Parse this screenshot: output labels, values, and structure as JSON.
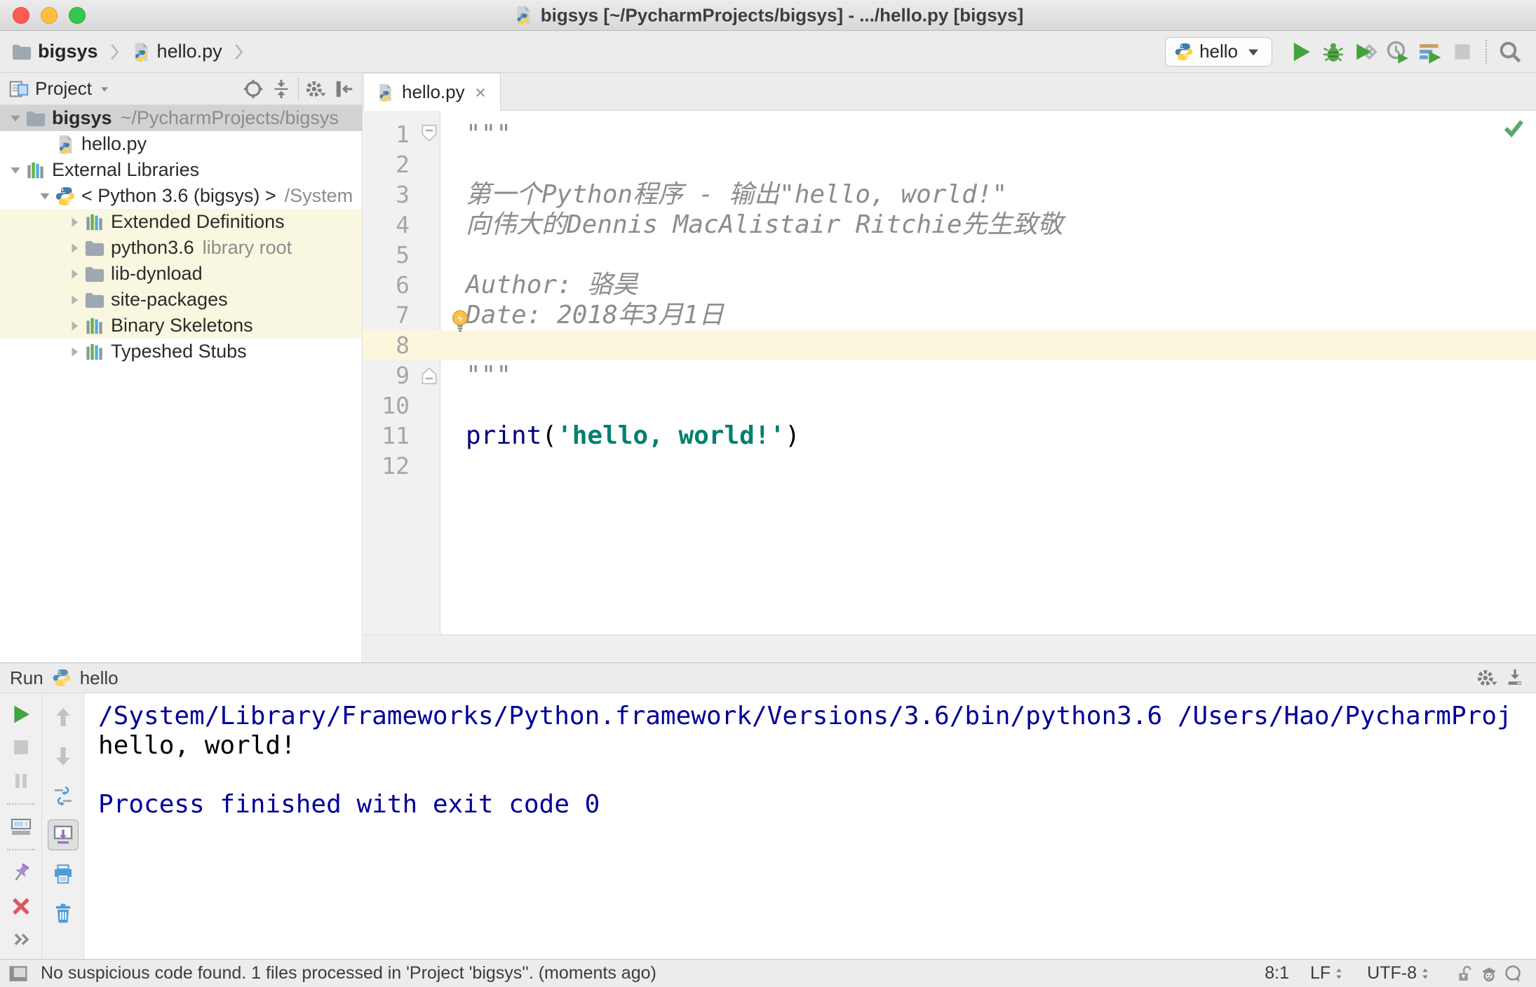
{
  "colors": {
    "toolbar_bg": "#ECECEC",
    "selection_gray": "#D2D2D2",
    "tree_highlight": "#FAF7E1",
    "caret_line": "#FCF6DD",
    "gutter_bg": "#F1F1F1",
    "gutter_border": "#D6D6D6",
    "run_green": "#45A33D",
    "error_red": "#DB5860",
    "pin_purple": "#A98FD0",
    "console_system": "#000099",
    "code_keyword": "#000080",
    "code_string": "#008070",
    "code_comment": "#8C8C8C",
    "icon_blue": "#4E9CD8",
    "ok_green": "#59A869"
  },
  "titlebar": {
    "title": "bigsys [~/PycharmProjects/bigsys] - .../hello.py [bigsys]",
    "window_buttons": [
      "close",
      "minimize",
      "zoom"
    ]
  },
  "toolbar": {
    "breadcrumbs": [
      {
        "label": "bigsys",
        "icon": "folder",
        "bold": true
      },
      {
        "label": "hello.py",
        "icon": "python-file",
        "bold": false
      }
    ],
    "run_config": {
      "icon": "python-logo",
      "label": "hello"
    },
    "actions": [
      "run",
      "debug",
      "run-with-coverage",
      "profiler",
      "concurrency-diagram",
      "stop",
      "separator",
      "search-everywhere"
    ]
  },
  "project_panel": {
    "title": "Project",
    "header_icons": [
      "locate",
      "collapse-all",
      "separator",
      "settings",
      "hide-panel"
    ],
    "tree": [
      {
        "label": "bigsys",
        "suffix": "~/PycharmProjects/bigsys",
        "level": 0,
        "expander": "down",
        "icon": "folder",
        "bold": true,
        "selected": true
      },
      {
        "label": "hello.py",
        "level": 1,
        "expander": "none",
        "icon": "python-file"
      },
      {
        "label": "External Libraries",
        "level": 0,
        "expander": "down",
        "icon": "library"
      },
      {
        "label": "< Python 3.6 (bigsys) >",
        "suffix": "/System",
        "level": 1,
        "expander": "down",
        "icon": "python-logo"
      },
      {
        "label": "Extended Definitions",
        "level": 2,
        "expander": "right",
        "icon": "library",
        "highlighted": true
      },
      {
        "label": "python3.6",
        "suffix": "library root",
        "level": 2,
        "expander": "right",
        "icon": "folder",
        "highlighted": true
      },
      {
        "label": "lib-dynload",
        "level": 2,
        "expander": "right",
        "icon": "folder",
        "highlighted": true
      },
      {
        "label": "site-packages",
        "level": 2,
        "expander": "right",
        "icon": "folder",
        "highlighted": true
      },
      {
        "label": "Binary Skeletons",
        "level": 2,
        "expander": "right",
        "icon": "library",
        "highlighted": true
      },
      {
        "label": "Typeshed Stubs",
        "level": 2,
        "expander": "right",
        "icon": "library",
        "highlighted": false
      }
    ]
  },
  "editor": {
    "tab": {
      "label": "hello.py",
      "icon": "python-file"
    },
    "inspection_status": "ok",
    "lines": [
      {
        "n": 1,
        "fold": "start",
        "tokens": [
          {
            "t": "\"\"\"",
            "c": "docstring"
          }
        ]
      },
      {
        "n": 2,
        "tokens": []
      },
      {
        "n": 3,
        "tokens": [
          {
            "t": "第一个Python程序 - 输出\"hello, world!\"",
            "c": "docstring"
          }
        ]
      },
      {
        "n": 4,
        "tokens": [
          {
            "t": "向伟大的Dennis MacAlistair Ritchie先生致敬",
            "c": "docstring"
          }
        ]
      },
      {
        "n": 5,
        "tokens": []
      },
      {
        "n": 6,
        "tokens": [
          {
            "t": "Author: 骆昊",
            "c": "docstring"
          }
        ]
      },
      {
        "n": 7,
        "bulb": true,
        "tokens": [
          {
            "t": "Date: 2018年3月1日",
            "c": "docstring"
          }
        ]
      },
      {
        "n": 8,
        "caret_line": true,
        "tokens": []
      },
      {
        "n": 9,
        "fold": "end",
        "tokens": [
          {
            "t": "\"\"\"",
            "c": "docstring"
          }
        ]
      },
      {
        "n": 10,
        "tokens": []
      },
      {
        "n": 11,
        "tokens": [
          {
            "t": "print",
            "c": "keyword"
          },
          {
            "t": "(",
            "c": "plain"
          },
          {
            "t": "'hello, world!'",
            "c": "string"
          },
          {
            "t": ")",
            "c": "plain"
          }
        ]
      },
      {
        "n": 12,
        "tokens": []
      }
    ]
  },
  "run_panel": {
    "title": "Run",
    "config_icon": "python-logo",
    "config_name": "hello",
    "header_icons": [
      "settings",
      "dock-down"
    ],
    "toolbar_main": [
      "rerun",
      "stop",
      "pause",
      "separator",
      "restore-layout",
      "separator",
      "pin",
      "close",
      "more"
    ],
    "toolbar_console": [
      "up-arrow",
      "down-arrow",
      "soft-wrap",
      "scroll-to-end",
      "print",
      "clear-all"
    ],
    "console": [
      {
        "text": "/System/Library/Frameworks/Python.framework/Versions/3.6/bin/python3.6 /Users/Hao/PycharmProj",
        "c": "system"
      },
      {
        "text": "hello, world!",
        "c": "stdout"
      },
      {
        "text": "",
        "c": "stdout"
      },
      {
        "text": "Process finished with exit code 0",
        "c": "system"
      }
    ]
  },
  "statusbar": {
    "toggle_icon": "toolwindows",
    "message": "No suspicious code found. 1 files processed in 'Project 'bigsys''. (moments ago)",
    "caret_position": "8:1",
    "line_separator": "LF",
    "encoding": "UTF-8",
    "right_icons": [
      "unlock",
      "hector",
      "feedback"
    ]
  }
}
